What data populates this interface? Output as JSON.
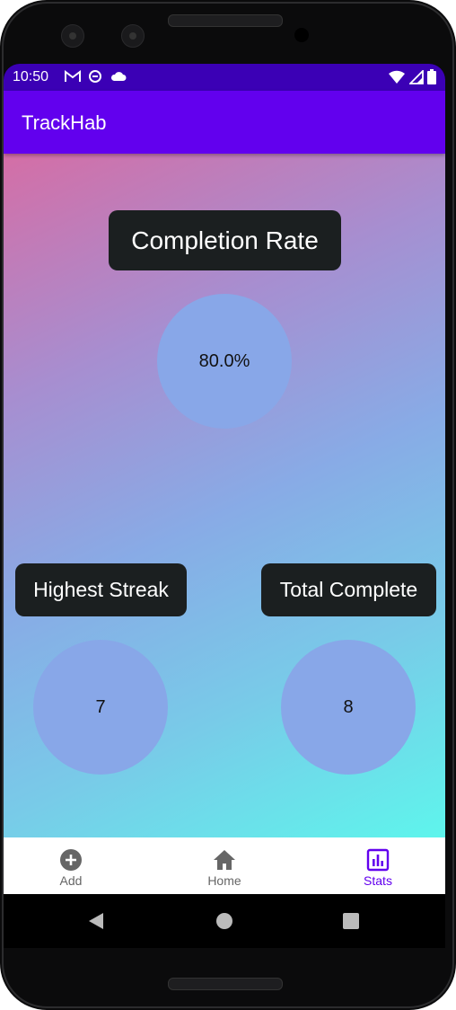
{
  "status_bar": {
    "time": "10:50",
    "notification_icons": [
      "gmail-icon",
      "sync-icon",
      "cloud-icon"
    ],
    "system_icons": [
      "wifi-icon",
      "signal-icon",
      "battery-icon"
    ]
  },
  "app_bar": {
    "title": "TrackHab"
  },
  "stats": {
    "completion_rate": {
      "label": "Completion Rate",
      "value": "80.0%"
    },
    "highest_streak": {
      "label": "Highest Streak",
      "value": "7"
    },
    "total_complete": {
      "label": "Total Complete",
      "value": "8"
    }
  },
  "bottom_nav": {
    "items": [
      {
        "label": "Add",
        "icon": "add-circle-icon"
      },
      {
        "label": "Home",
        "icon": "home-icon"
      },
      {
        "label": "Stats",
        "icon": "bar-chart-icon"
      }
    ],
    "selected": "Stats"
  },
  "colors": {
    "app_bar": "#6200ee",
    "status_bar": "#3b00b5",
    "accent": "#6200ee",
    "card": "#1b1f20",
    "circle": "#88a7e8",
    "gradient_start": "#d46ea6",
    "gradient_end": "#5ef5ec"
  }
}
